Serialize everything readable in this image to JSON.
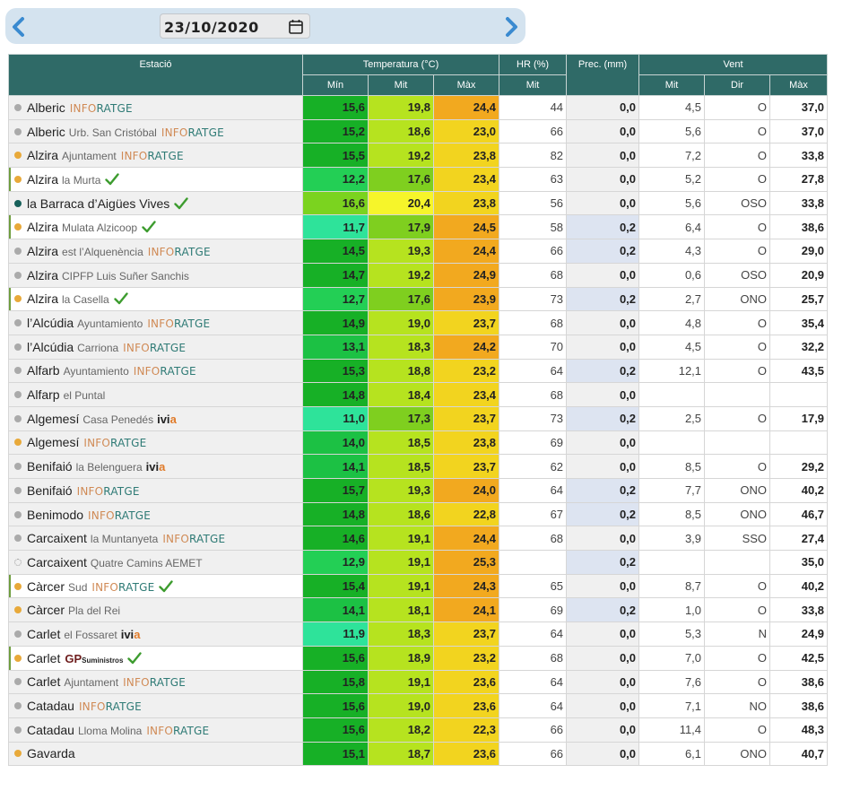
{
  "date": "23/10/2020",
  "icons": {
    "prev": "chevron-left-icon",
    "next": "chevron-right-icon",
    "calendar": "calendar-icon",
    "check": "check-icon"
  },
  "colors": {
    "header_bg": "#2f6a67",
    "inforatge_a": "#d08a55",
    "inforatge_b": "#2e7a75",
    "ivia_a": "#222222",
    "ivia_b": "#e07b2a",
    "check": "#3d9c2f",
    "prec_positive_bg": "#dde4f1"
  },
  "header": {
    "station": "Estació",
    "temperature": "Temperatura (°C)",
    "humidity": "HR (%)",
    "precipitation": "Prec. (mm)",
    "wind": "Vent",
    "t_min": "Mín",
    "t_mit": "Mit",
    "t_max": "Màx",
    "hr_mit": "Mit",
    "w_mit": "Mit",
    "w_dir": "Dir",
    "w_max": "Màx"
  },
  "sources": {
    "inforatge_a": "INFO",
    "inforatge_b": "RATGE",
    "ivia_a": "ivi",
    "ivia_b": "a",
    "gp_a": "GP",
    "gp_b": "Suministros"
  },
  "rows": [
    {
      "name": "Alberic",
      "sub": "",
      "source": "inforatge",
      "check": false,
      "dot": "grey",
      "highlight": false,
      "tmin": "15,6",
      "tmit": "19,8",
      "tmax": "24,4",
      "cmin": "#17b026",
      "cmit": "#b6e31f",
      "cmax": "#f2a91f",
      "hr": "44",
      "prec": "0,0",
      "wmit": "4,5",
      "wdir": "O",
      "wmax": "37,0"
    },
    {
      "name": "Alberic",
      "sub": "Urb. San Cristóbal",
      "source": "inforatge",
      "check": false,
      "dot": "grey",
      "highlight": false,
      "tmin": "15,2",
      "tmit": "18,6",
      "tmax": "23,0",
      "cmin": "#17b026",
      "cmit": "#b6e31f",
      "cmax": "#f2d41f",
      "hr": "66",
      "prec": "0,0",
      "wmit": "5,6",
      "wdir": "O",
      "wmax": "37,0"
    },
    {
      "name": "Alzira",
      "sub": "Ajuntament",
      "source": "inforatge",
      "check": false,
      "dot": "orange",
      "highlight": false,
      "tmin": "15,5",
      "tmit": "19,2",
      "tmax": "23,8",
      "cmin": "#17b026",
      "cmit": "#b6e31f",
      "cmax": "#f2d41f",
      "hr": "82",
      "prec": "0,0",
      "wmit": "7,2",
      "wdir": "O",
      "wmax": "33,8"
    },
    {
      "name": "Alzira",
      "sub": "la Murta",
      "source": "",
      "check": true,
      "dot": "orange",
      "highlight": true,
      "tmin": "12,2",
      "tmit": "17,6",
      "tmax": "23,4",
      "cmin": "#23cf55",
      "cmit": "#7fcf1f",
      "cmax": "#f2d41f",
      "hr": "63",
      "prec": "0,0",
      "wmit": "5,2",
      "wdir": "O",
      "wmax": "27,8"
    },
    {
      "name": "la Barraca d’Aigües Vives",
      "sub": "",
      "source": "",
      "check": true,
      "dot": "teal",
      "highlight": false,
      "tmin": "16,6",
      "tmit": "20,4",
      "tmax": "23,8",
      "cmin": "#7bd31f",
      "cmit": "#f6f52a",
      "cmax": "#f2d41f",
      "hr": "56",
      "prec": "0,0",
      "wmit": "5,6",
      "wdir": "OSO",
      "wmax": "33,8"
    },
    {
      "name": "Alzira",
      "sub": "Mulata Alzicoop",
      "source": "",
      "check": true,
      "dot": "orange",
      "highlight": true,
      "tmin": "11,7",
      "tmit": "17,9",
      "tmax": "24,5",
      "cmin": "#2ee39a",
      "cmit": "#7fcf1f",
      "cmax": "#f2a91f",
      "hr": "58",
      "prec": "0,2",
      "wmit": "6,4",
      "wdir": "O",
      "wmax": "38,6"
    },
    {
      "name": "Alzira",
      "sub": "est l’Alquenència",
      "source": "inforatge",
      "check": false,
      "dot": "grey",
      "highlight": false,
      "tmin": "14,5",
      "tmit": "19,3",
      "tmax": "24,4",
      "cmin": "#17b026",
      "cmit": "#b6e31f",
      "cmax": "#f2a91f",
      "hr": "66",
      "prec": "0,2",
      "wmit": "4,3",
      "wdir": "O",
      "wmax": "29,0"
    },
    {
      "name": "Alzira",
      "sub": "CIPFP Luis Suñer Sanchis",
      "source": "",
      "check": false,
      "dot": "grey",
      "highlight": false,
      "tmin": "14,7",
      "tmit": "19,2",
      "tmax": "24,9",
      "cmin": "#17b026",
      "cmit": "#b6e31f",
      "cmax": "#f2a91f",
      "hr": "68",
      "prec": "0,0",
      "wmit": "0,6",
      "wdir": "OSO",
      "wmax": "20,9"
    },
    {
      "name": "Alzira",
      "sub": "la Casella",
      "source": "",
      "check": true,
      "dot": "orange",
      "highlight": true,
      "tmin": "12,7",
      "tmit": "17,6",
      "tmax": "23,9",
      "cmin": "#23cf55",
      "cmit": "#7fcf1f",
      "cmax": "#f2a91f",
      "hr": "73",
      "prec": "0,2",
      "wmit": "2,7",
      "wdir": "ONO",
      "wmax": "25,7"
    },
    {
      "name": "l’Alcúdia",
      "sub": "Ayuntamiento",
      "source": "inforatge",
      "check": false,
      "dot": "grey",
      "highlight": false,
      "tmin": "14,9",
      "tmit": "19,0",
      "tmax": "23,7",
      "cmin": "#17b026",
      "cmit": "#b6e31f",
      "cmax": "#f2d41f",
      "hr": "68",
      "prec": "0,0",
      "wmit": "4,8",
      "wdir": "O",
      "wmax": "35,4"
    },
    {
      "name": "l’Alcúdia",
      "sub": "Carriona",
      "source": "inforatge",
      "check": false,
      "dot": "grey",
      "highlight": false,
      "tmin": "13,1",
      "tmit": "18,3",
      "tmax": "24,2",
      "cmin": "#1cc144",
      "cmit": "#b6e31f",
      "cmax": "#f2a91f",
      "hr": "70",
      "prec": "0,0",
      "wmit": "4,5",
      "wdir": "O",
      "wmax": "32,2"
    },
    {
      "name": "Alfarb",
      "sub": "Ayuntamiento",
      "source": "inforatge",
      "check": false,
      "dot": "grey",
      "highlight": false,
      "tmin": "15,3",
      "tmit": "18,8",
      "tmax": "23,2",
      "cmin": "#17b026",
      "cmit": "#b6e31f",
      "cmax": "#f2d41f",
      "hr": "64",
      "prec": "0,2",
      "wmit": "12,1",
      "wdir": "O",
      "wmax": "43,5"
    },
    {
      "name": "Alfarp",
      "sub": "el Puntal",
      "source": "",
      "check": false,
      "dot": "grey",
      "highlight": false,
      "tmin": "14,8",
      "tmit": "18,4",
      "tmax": "23,4",
      "cmin": "#17b026",
      "cmit": "#b6e31f",
      "cmax": "#f2d41f",
      "hr": "68",
      "prec": "0,0",
      "wmit": "",
      "wdir": "",
      "wmax": ""
    },
    {
      "name": "Algemesí",
      "sub": "Casa Penedés",
      "source": "ivia",
      "check": false,
      "dot": "grey",
      "highlight": false,
      "tmin": "11,0",
      "tmit": "17,3",
      "tmax": "23,7",
      "cmin": "#2ee39a",
      "cmit": "#7fcf1f",
      "cmax": "#f2d41f",
      "hr": "73",
      "prec": "0,2",
      "wmit": "2,5",
      "wdir": "O",
      "wmax": "17,9"
    },
    {
      "name": "Algemesí",
      "sub": "",
      "source": "inforatge",
      "check": false,
      "dot": "orange",
      "highlight": false,
      "tmin": "14,0",
      "tmit": "18,5",
      "tmax": "23,8",
      "cmin": "#1cc144",
      "cmit": "#b6e31f",
      "cmax": "#f2d41f",
      "hr": "69",
      "prec": "0,0",
      "wmit": "",
      "wdir": "",
      "wmax": ""
    },
    {
      "name": "Benifaió",
      "sub": "la Belenguera",
      "source": "ivia",
      "check": false,
      "dot": "grey",
      "highlight": false,
      "tmin": "14,1",
      "tmit": "18,5",
      "tmax": "23,7",
      "cmin": "#1cc144",
      "cmit": "#b6e31f",
      "cmax": "#f2d41f",
      "hr": "62",
      "prec": "0,0",
      "wmit": "8,5",
      "wdir": "O",
      "wmax": "29,2"
    },
    {
      "name": "Benifaió",
      "sub": "",
      "source": "inforatge",
      "check": false,
      "dot": "grey",
      "highlight": false,
      "tmin": "15,7",
      "tmit": "19,3",
      "tmax": "24,0",
      "cmin": "#17b026",
      "cmit": "#b6e31f",
      "cmax": "#f2a91f",
      "hr": "64",
      "prec": "0,2",
      "wmit": "7,7",
      "wdir": "ONO",
      "wmax": "40,2"
    },
    {
      "name": "Benimodo",
      "sub": "",
      "source": "inforatge",
      "check": false,
      "dot": "grey",
      "highlight": false,
      "tmin": "14,8",
      "tmit": "18,6",
      "tmax": "22,8",
      "cmin": "#17b026",
      "cmit": "#b6e31f",
      "cmax": "#f2d41f",
      "hr": "67",
      "prec": "0,2",
      "wmit": "8,5",
      "wdir": "ONO",
      "wmax": "46,7"
    },
    {
      "name": "Carcaixent",
      "sub": "la Muntanyeta",
      "source": "inforatge",
      "check": false,
      "dot": "grey",
      "highlight": false,
      "tmin": "14,6",
      "tmit": "19,1",
      "tmax": "24,4",
      "cmin": "#17b026",
      "cmit": "#b6e31f",
      "cmax": "#f2a91f",
      "hr": "68",
      "prec": "0,0",
      "wmit": "3,9",
      "wdir": "SSO",
      "wmax": "27,4"
    },
    {
      "name": "Carcaixent",
      "sub": "Quatre Camins AEMET",
      "source": "",
      "check": false,
      "dot": "hollow",
      "highlight": false,
      "tmin": "12,9",
      "tmit": "19,1",
      "tmax": "25,3",
      "cmin": "#23cf55",
      "cmit": "#b6e31f",
      "cmax": "#f2a91f",
      "hr": "",
      "prec": "0,2",
      "wmit": "",
      "wdir": "",
      "wmax": "35,0"
    },
    {
      "name": "Càrcer",
      "sub": "Sud",
      "source": "inforatge",
      "check": true,
      "dot": "orange",
      "highlight": true,
      "tmin": "15,4",
      "tmit": "19,1",
      "tmax": "24,3",
      "cmin": "#17b026",
      "cmit": "#b6e31f",
      "cmax": "#f2a91f",
      "hr": "65",
      "prec": "0,0",
      "wmit": "8,7",
      "wdir": "O",
      "wmax": "40,2"
    },
    {
      "name": "Càrcer",
      "sub": "Pla del Rei",
      "source": "",
      "check": false,
      "dot": "orange",
      "highlight": false,
      "tmin": "14,1",
      "tmit": "18,1",
      "tmax": "24,1",
      "cmin": "#1cc144",
      "cmit": "#b6e31f",
      "cmax": "#f2a91f",
      "hr": "69",
      "prec": "0,2",
      "wmit": "1,0",
      "wdir": "O",
      "wmax": "33,8"
    },
    {
      "name": "Carlet",
      "sub": "el Fossaret",
      "source": "ivia",
      "check": false,
      "dot": "grey",
      "highlight": false,
      "tmin": "11,9",
      "tmit": "18,3",
      "tmax": "23,7",
      "cmin": "#2ee39a",
      "cmit": "#b6e31f",
      "cmax": "#f2d41f",
      "hr": "64",
      "prec": "0,0",
      "wmit": "5,3",
      "wdir": "N",
      "wmax": "24,9"
    },
    {
      "name": "Carlet",
      "sub": "",
      "source": "gp",
      "check": true,
      "dot": "orange",
      "highlight": true,
      "tmin": "15,6",
      "tmit": "18,9",
      "tmax": "23,2",
      "cmin": "#17b026",
      "cmit": "#b6e31f",
      "cmax": "#f2d41f",
      "hr": "68",
      "prec": "0,0",
      "wmit": "7,0",
      "wdir": "O",
      "wmax": "42,5"
    },
    {
      "name": "Carlet",
      "sub": "Ajuntament",
      "source": "inforatge",
      "check": false,
      "dot": "grey",
      "highlight": false,
      "tmin": "15,8",
      "tmit": "19,1",
      "tmax": "23,6",
      "cmin": "#17b026",
      "cmit": "#b6e31f",
      "cmax": "#f2d41f",
      "hr": "64",
      "prec": "0,0",
      "wmit": "7,6",
      "wdir": "O",
      "wmax": "38,6"
    },
    {
      "name": "Catadau",
      "sub": "",
      "source": "inforatge",
      "check": false,
      "dot": "grey",
      "highlight": false,
      "tmin": "15,6",
      "tmit": "19,0",
      "tmax": "23,6",
      "cmin": "#17b026",
      "cmit": "#b6e31f",
      "cmax": "#f2d41f",
      "hr": "64",
      "prec": "0,0",
      "wmit": "7,1",
      "wdir": "NO",
      "wmax": "38,6"
    },
    {
      "name": "Catadau",
      "sub": "Lloma Molina",
      "source": "inforatge",
      "check": false,
      "dot": "grey",
      "highlight": false,
      "tmin": "15,6",
      "tmit": "18,2",
      "tmax": "22,3",
      "cmin": "#17b026",
      "cmit": "#b6e31f",
      "cmax": "#f2d41f",
      "hr": "66",
      "prec": "0,0",
      "wmit": "11,4",
      "wdir": "O",
      "wmax": "48,3"
    },
    {
      "name": "Gavarda",
      "sub": "",
      "source": "",
      "check": false,
      "dot": "orange",
      "highlight": false,
      "tmin": "15,1",
      "tmit": "18,7",
      "tmax": "23,6",
      "cmin": "#17b026",
      "cmit": "#b6e31f",
      "cmax": "#f2d41f",
      "hr": "66",
      "prec": "0,0",
      "wmit": "6,1",
      "wdir": "ONO",
      "wmax": "40,7"
    }
  ]
}
